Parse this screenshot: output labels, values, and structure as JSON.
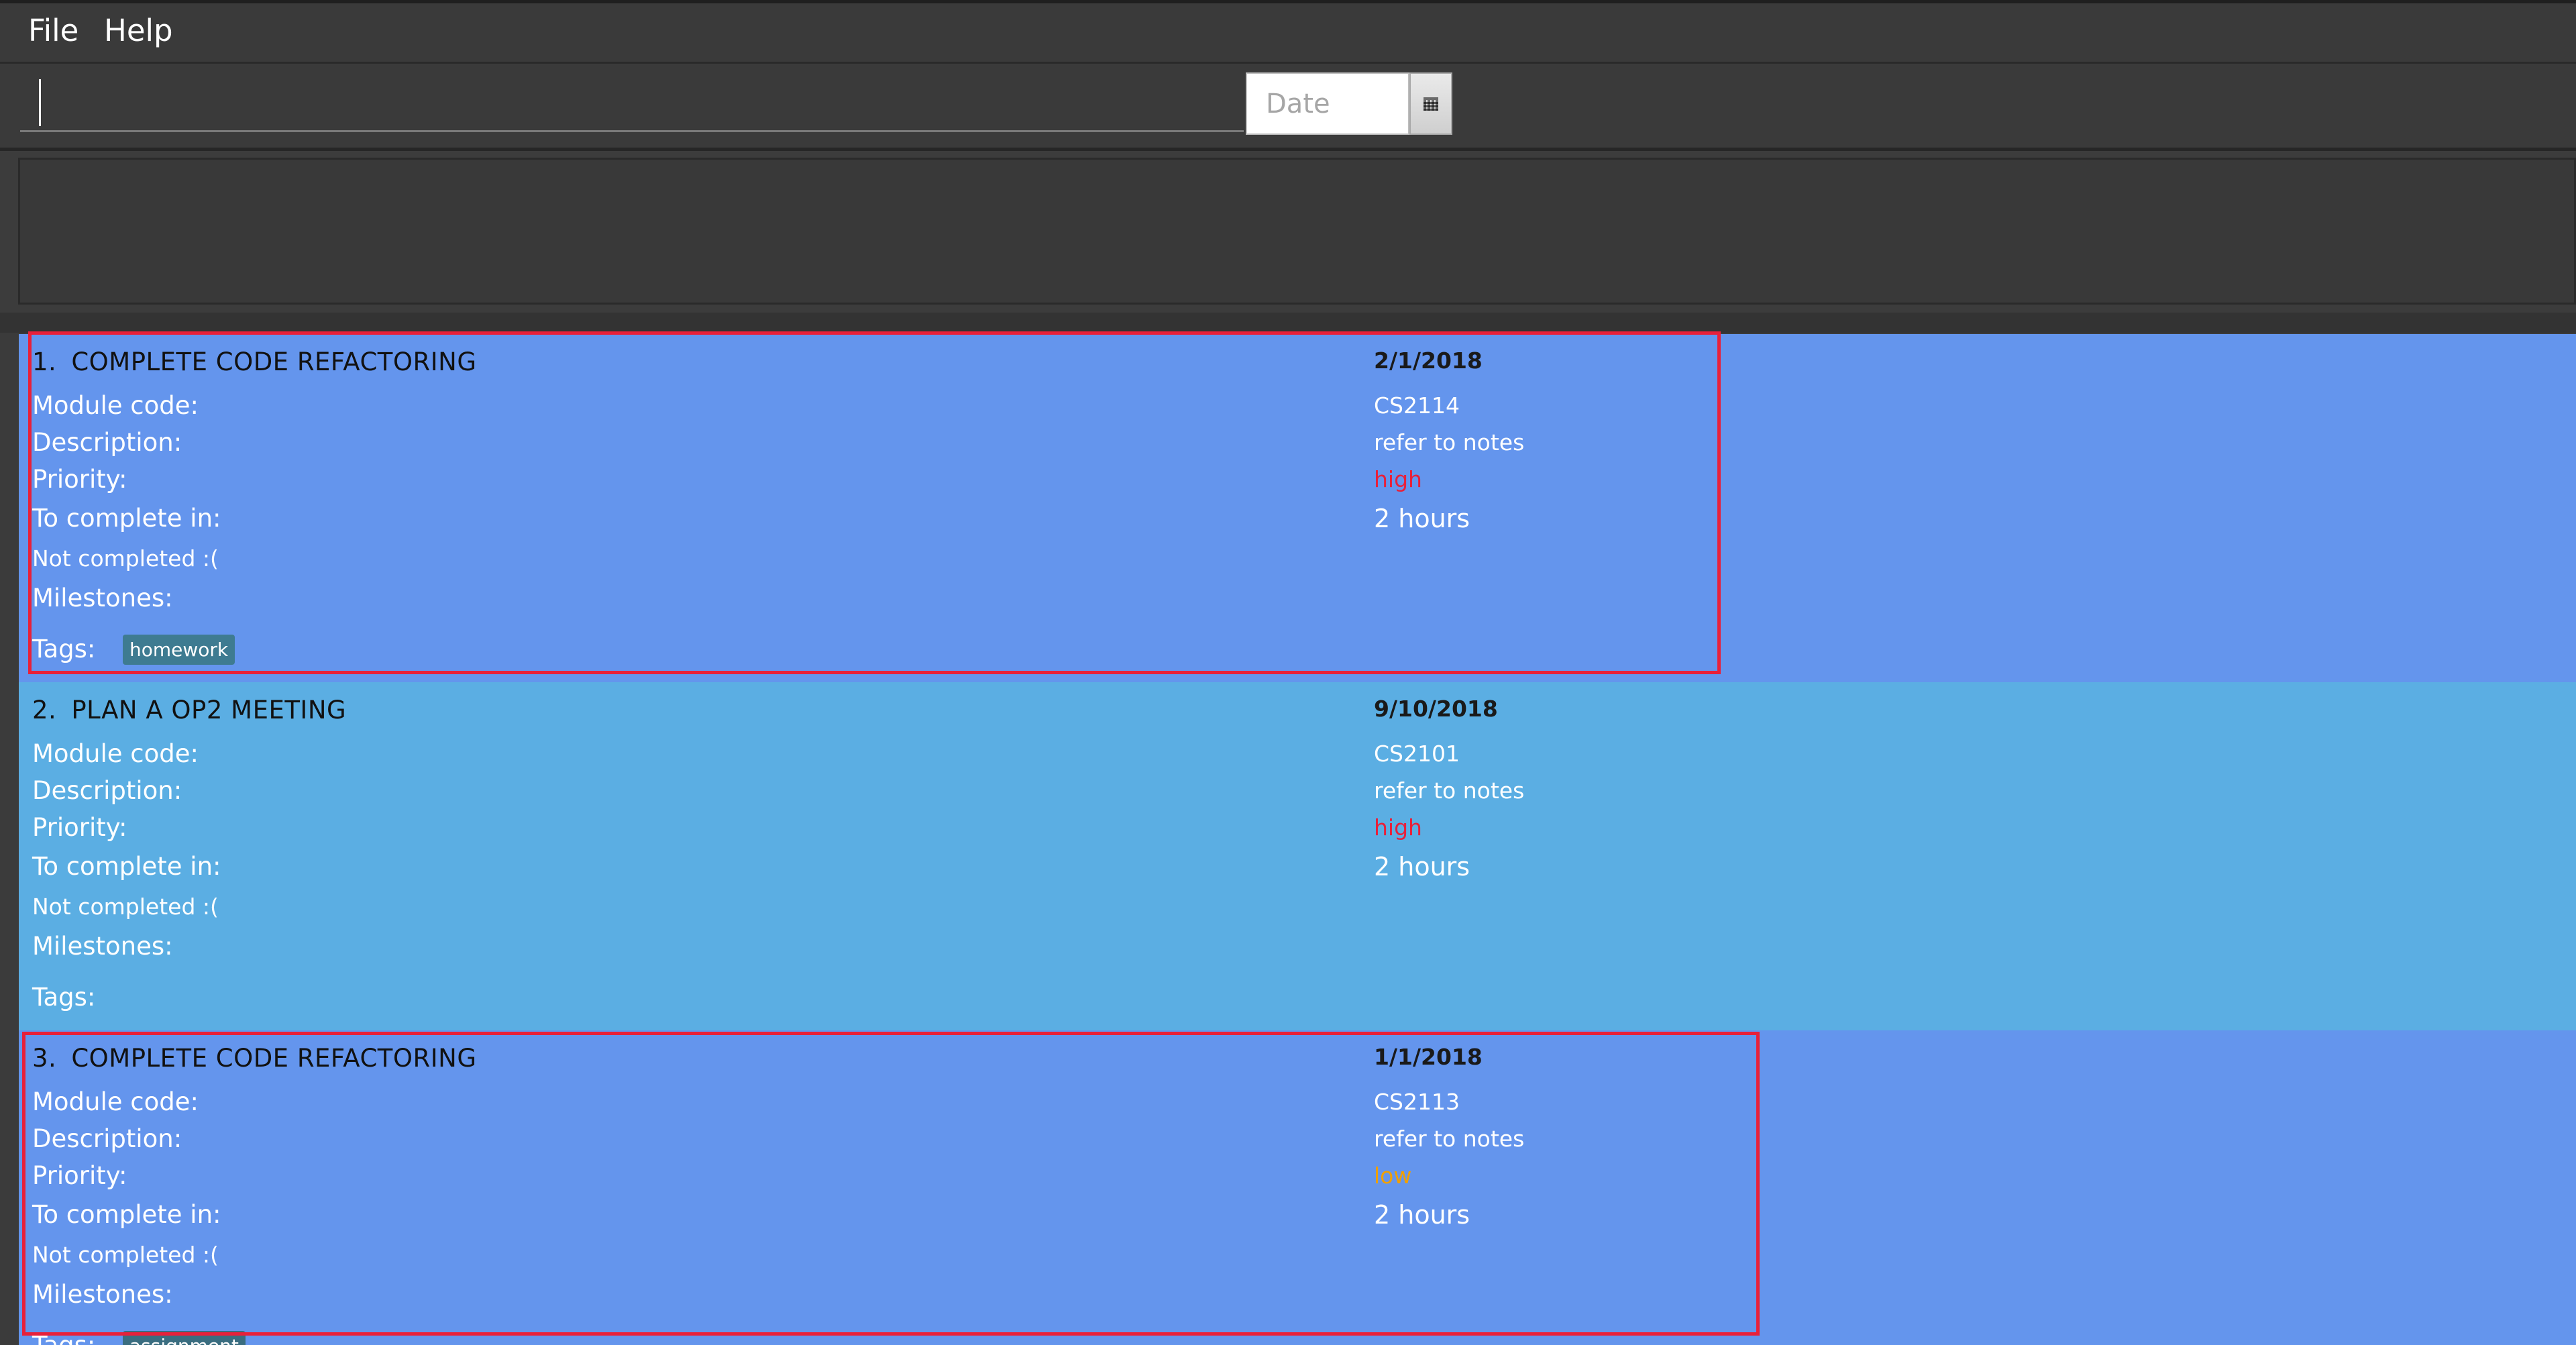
{
  "menu": {
    "file": "File",
    "help": "Help"
  },
  "command": {
    "value": "",
    "date_placeholder": "Date"
  },
  "result": {
    "text": ""
  },
  "labels": {
    "module": "Module code:",
    "description": "Description:",
    "priority": "Priority:",
    "time": "To complete in:",
    "milestones": "Milestones:",
    "tags": "Tags:"
  },
  "tasks": [
    {
      "index": "1.",
      "title": "COMPLETE CODE REFACTORING",
      "deadline": "2/1/2018",
      "module": "CS2114",
      "description": "refer to notes",
      "priority": "high",
      "time": "2 hours",
      "status": "Not completed :(",
      "tags": [
        "homework"
      ],
      "selected": true,
      "background": "#6495ed"
    },
    {
      "index": "2.",
      "title": "PLAN A OP2 MEETING",
      "deadline": "9/10/2018",
      "module": "CS2101",
      "description": "refer to notes",
      "priority": "high",
      "time": "2 hours",
      "status": "Not completed :(",
      "tags": [],
      "selected": false,
      "background": "#5baee3"
    },
    {
      "index": "3.",
      "title": "COMPLETE CODE REFACTORING",
      "deadline": "1/1/2018",
      "module": "CS2113",
      "description": "refer to notes",
      "priority": "low",
      "time": "2 hours",
      "status": "Not completed :(",
      "tags": [
        "assignment"
      ],
      "selected": true,
      "background": "#6495ed"
    }
  ],
  "colors": {
    "selection_border": "#e8203a",
    "priority_high": "#e8203a",
    "priority_low": "#f0a000",
    "tag_bg": "#3e7b91"
  }
}
